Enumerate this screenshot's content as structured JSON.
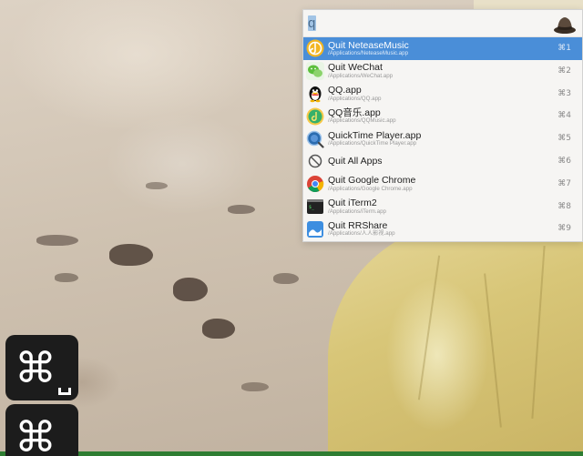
{
  "search": {
    "value": "q",
    "placeholder": ""
  },
  "results": [
    {
      "title": "Quit NeteaseMusic",
      "subtitle": "/Applications/NeteaseMusic.app",
      "shortcut": "⌘1",
      "icon": "netease-music-icon",
      "selected": true
    },
    {
      "title": "Quit WeChat",
      "subtitle": "/Applications/WeChat.app",
      "shortcut": "⌘2",
      "icon": "wechat-icon"
    },
    {
      "title": "QQ.app",
      "subtitle": "/Applications/QQ.app",
      "shortcut": "⌘3",
      "icon": "qq-penguin-icon"
    },
    {
      "title": "QQ音乐.app",
      "subtitle": "/Applications/QQMusic.app",
      "shortcut": "⌘4",
      "icon": "qq-music-icon"
    },
    {
      "title": "QuickTime Player.app",
      "subtitle": "/Applications/QuickTime Player.app",
      "shortcut": "⌘5",
      "icon": "quicktime-icon"
    },
    {
      "title": "Quit All Apps",
      "subtitle": "",
      "shortcut": "⌘6",
      "icon": "prohibited-icon"
    },
    {
      "title": "Quit Google Chrome",
      "subtitle": "/Applications/Google Chrome.app",
      "shortcut": "⌘7",
      "icon": "chrome-icon"
    },
    {
      "title": "Quit iTerm2",
      "subtitle": "/Applications/iTerm.app",
      "shortcut": "⌘8",
      "icon": "iterm-icon"
    },
    {
      "title": "Quit RRShare",
      "subtitle": "/Applications/人人影视.app",
      "shortcut": "⌘9",
      "icon": "rrshare-icon"
    }
  ],
  "keyboard_indicator": {
    "key_top": "⌘",
    "key_bottom": "⌘"
  },
  "colors": {
    "selection": "#4a8ed8",
    "launcher_bg": "#f6f5f3"
  }
}
